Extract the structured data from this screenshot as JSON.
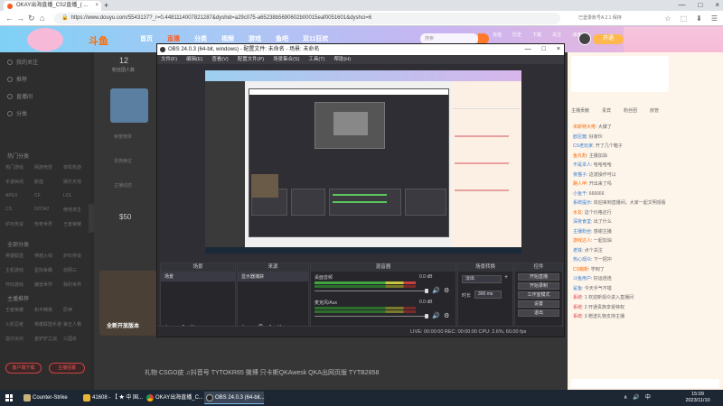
{
  "browser": {
    "tab_title": "OKAY出海直播_CS2直播_( ...",
    "tab_close": "×",
    "new_tab": "+",
    "url": "https://www.douyu.com/5543137?_r=0.4481114007821287&dyshid=a29c075-a65238b5690602b00015eaf0051601&dyshci=6",
    "right_info": "已登录账号A 2.1 保持",
    "win_buttons": [
      "—",
      "□",
      "×"
    ],
    "nav": [
      "←",
      "→",
      "↻",
      "⌂"
    ],
    "toolbar_icons": [
      "☆",
      "⬚",
      "⬇",
      "☰"
    ]
  },
  "douyu": {
    "logo": "斗鱼",
    "nav": [
      "首页",
      "直播",
      "分类",
      "视频",
      "游戏",
      "鱼吧",
      "双11狂欢"
    ],
    "nav_active": 1,
    "search_placeholder": "搜索",
    "header_icons": [
      "充值",
      "历史",
      "下载",
      "关注",
      "消息"
    ],
    "vip": "开通"
  },
  "sidebar": {
    "items": [
      "我的关注",
      "推荐",
      "直播间",
      "分类",
      "游戏"
    ],
    "section1": "热门分类",
    "grid1": [
      "热门游戏",
      "网游竞技",
      "单机热游",
      "手游休闲",
      "颜值",
      "娱乐天地",
      "APEX",
      "CF",
      "LOL",
      "CS",
      "DOTA2",
      "绝地求生",
      "炉石传说",
      "传奇世界",
      "王者荣耀",
      "户外",
      "美食",
      "一起看"
    ],
    "section2": "全部分类",
    "grid2": [
      "英雄联盟",
      "穿越火线",
      "炉石传说",
      "主机游戏",
      "星际争霸",
      "剑网三",
      "怀旧游戏",
      "魔兽世界",
      "我的世界",
      "主机游戏",
      "DNF",
      "绝地求生",
      "QQ飞车",
      "球球大作战",
      "和平精英"
    ],
    "section3": "主播推荐",
    "grid3": [
      "王者荣耀",
      "和平精英",
      "原神",
      "火影忍者",
      "英雄联盟手游",
      "第五人格",
      "蛋仔派对",
      "金铲铲之战",
      "三国杀"
    ],
    "btn_left": "客户端下载",
    "btn_right": "主播招募"
  },
  "stream": {
    "count": "12",
    "count_label": "粉丝团人数",
    "list": [
      "荣誉榜单",
      "贵族席位",
      "主播动态"
    ],
    "value": "$50",
    "hot_label": "全新开放版本",
    "bottom_bar": "礼物   CSGO皮   ♫抖音号   TYTOKR65   微博   只卡斯QKAwesk   QKA出网页版   TYTB2858"
  },
  "chat": {
    "tabs": [
      "主播贡献",
      "贵宾",
      "粉丝团",
      "房管"
    ],
    "lines": [
      {
        "name": "米斯特大佬",
        "text": ": 大爆了"
      },
      {
        "name": "欧尼酱",
        "text": ": 好家伙"
      },
      {
        "name": "CS老玩家",
        "text": ": 开了几个箱子"
      },
      {
        "name": "鱼丸粉",
        "text": ": 主播加油"
      },
      {
        "name": "不是本人",
        "text": ": 哈哈哈哈"
      },
      {
        "name": "夜猫子",
        "text": ": 这波操作可以"
      },
      {
        "name": "路人甲",
        "text": ": 开出来了吗"
      },
      {
        "name": "小鱼干",
        "text": ": 666666"
      },
      {
        "name": "系统提示",
        "text": ": 欢迎来到直播间，大家一起文明观看"
      },
      {
        "name": "水友",
        "text": ": 这个价格还行"
      },
      {
        "name": "深夜食堂",
        "text": ": 出了什么"
      },
      {
        "name": "主播粉丝",
        "text": ": 感谢主播"
      },
      {
        "name": "游戏达人",
        "text": ": 一起加油"
      },
      {
        "name": "老铁",
        "text": ": 点个关注"
      },
      {
        "name": "热心观众",
        "text": ": 下一把冲"
      },
      {
        "name": "CS萌新",
        "text": ": 学到了"
      },
      {
        "name": "斗鱼用户",
        "text": ": 好运连连"
      },
      {
        "name": "鲨鱼",
        "text": ": 今天手气不错"
      },
      {
        "name": "系统",
        "text": ": 1 欢迎新观众进入直播间"
      },
      {
        "name": "系统",
        "text": ": 2 开通贵族享受特权"
      },
      {
        "name": "系统",
        "text": ": 3 赠送礼物支持主播"
      }
    ]
  },
  "obs": {
    "title": "OBS 24.0.3 (64-bit, windows) - 配置文件: 未命名 - 场景: 未命名",
    "menu": [
      "文件(F)",
      "编辑(E)",
      "查看(V)",
      "配置文件(P)",
      "场景集合(S)",
      "工具(T)",
      "帮助(H)"
    ],
    "docks": {
      "scenes": "场景",
      "sources": "来源",
      "mixer": "混音器",
      "transitions": "场景转换",
      "controls": "控件"
    },
    "scene_item": "场景",
    "source_item": "显示器捕获",
    "mixer_rows": [
      {
        "name": "桌面音频",
        "db": "0.0 dB"
      },
      {
        "name": "麦克风/Aux",
        "db": "0.0 dB"
      }
    ],
    "transition_type": "淡出",
    "duration_label": "时长",
    "duration_value": "300 ms",
    "control_buttons": [
      "开始直播",
      "开始录制",
      "工作室模式",
      "设置",
      "退出"
    ],
    "status": "LIVE: 00:00:00     REC: 00:00:00     CPU: 2.6%, 60.00 fps"
  },
  "taskbar": {
    "items": [
      "Counter-Strike",
      "41608 - 【 ★ 中 国...",
      "OKAY出海直播_C...",
      "OBS 24.0.3 (64-bit..."
    ],
    "tray": [
      "∧",
      "🔊",
      "中"
    ],
    "time": "15:09",
    "date": "2023/11/10"
  },
  "colors": {
    "douyu_orange": "#ff6a00",
    "obs_bg": "#2e2e34",
    "chat_bg": "#fdf4ea"
  }
}
